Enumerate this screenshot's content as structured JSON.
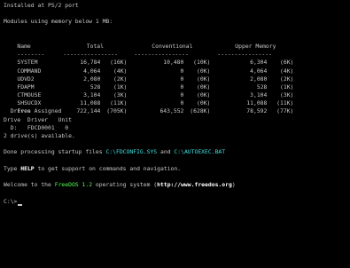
{
  "top_line": "Installed at PS/2 port",
  "modules_heading": "Modules using memory below 1 MB:",
  "table": {
    "headers": {
      "name": "Name",
      "total": "Total",
      "conventional": "Conventional",
      "upper": "Upper Memory"
    },
    "dash_name": "--------",
    "dash_total": "----------------",
    "dash_conv": "----------------",
    "dash_upper": "----------------",
    "rows": [
      {
        "name": "SYSTEM",
        "total": "16,784",
        "total_k": "(16K)",
        "conv": "10,480",
        "conv_k": "(10K)",
        "upper": "6,304",
        "upper_k": "(6K)"
      },
      {
        "name": "COMMAND",
        "total": "4,064",
        "total_k": "(4K)",
        "conv": "0",
        "conv_k": "(0K)",
        "upper": "4,064",
        "upper_k": "(4K)"
      },
      {
        "name": "UDVD2",
        "total": "2,080",
        "total_k": "(2K)",
        "conv": "0",
        "conv_k": "(0K)",
        "upper": "2,080",
        "upper_k": "(2K)"
      },
      {
        "name": "FDAPM",
        "total": "528",
        "total_k": "(1K)",
        "conv": "0",
        "conv_k": "(0K)",
        "upper": "528",
        "upper_k": "(1K)"
      },
      {
        "name": "CTMOUSE",
        "total": "3,104",
        "total_k": "(3K)",
        "conv": "0",
        "conv_k": "(0K)",
        "upper": "3,104",
        "upper_k": "(3K)"
      },
      {
        "name": "SHSUCDX",
        "total": "11,088",
        "total_k": "(11K)",
        "conv": "0",
        "conv_k": "(0K)",
        "upper": "11,088",
        "upper_k": "(11K)"
      },
      {
        "name": "Free",
        "total": "722,144",
        "total_k": "(705K)",
        "conv": "643,552",
        "conv_k": "(628K)",
        "upper": "78,592",
        "upper_k": "(77K)"
      }
    ]
  },
  "drives": {
    "assigned": "  Drives Assigned",
    "header": "Drive  Driver   Unit",
    "row": "  D:   FDCD0001   0",
    "available": "2 drive(s) available."
  },
  "done": {
    "prefix": "Done processing startup files ",
    "file1": "C:\\FDCONFIG.SYS",
    "mid": " and ",
    "file2": "C:\\AUTOEXEC.BAT"
  },
  "help": {
    "prefix": "Type ",
    "keyword": "HELP",
    "suffix": " to get support on commands and navigation."
  },
  "welcome": {
    "prefix": "Welcome to the ",
    "product": "FreeDOS 1.2",
    "mid": " operating system (",
    "url": "http://www.freedos.org",
    "suffix": ")"
  },
  "prompt": "C:\\>",
  "colors": {
    "background": "#000000",
    "text": "#c8c8c8",
    "highlight": "#ffffff",
    "cyan": "#3fe0e0",
    "green": "#55ff55",
    "yellow": "#ffff55"
  }
}
